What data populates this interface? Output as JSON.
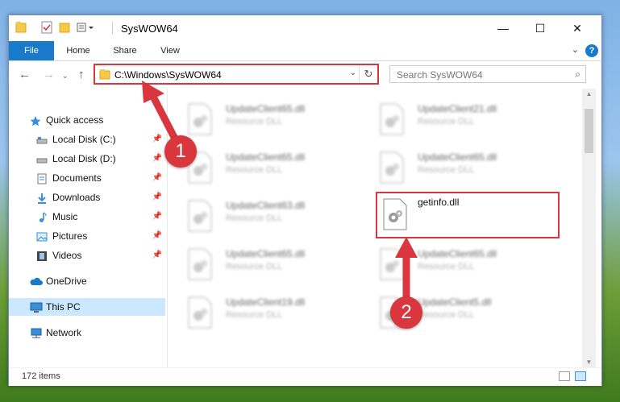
{
  "window": {
    "title": "SysWOW64",
    "controls": {
      "minimize": "—",
      "maximize": "☐",
      "close": "✕"
    }
  },
  "ribbon": {
    "tabs": [
      "File",
      "Home",
      "Share",
      "View"
    ],
    "help": "?"
  },
  "address": {
    "path": "C:\\Windows\\SysWOW64",
    "search_placeholder": "Search SysWOW64"
  },
  "nav_pane": {
    "items": [
      {
        "label": "Quick access",
        "icon": "star-icon",
        "pinned": false
      },
      {
        "label": "Local Disk (C:)",
        "icon": "drive-icon",
        "pinned": true
      },
      {
        "label": "Local Disk (D:)",
        "icon": "drive-icon",
        "pinned": true
      },
      {
        "label": "Documents",
        "icon": "documents-icon",
        "pinned": true
      },
      {
        "label": "Downloads",
        "icon": "download-icon",
        "pinned": true
      },
      {
        "label": "Music",
        "icon": "music-icon",
        "pinned": true
      },
      {
        "label": "Pictures",
        "icon": "pictures-icon",
        "pinned": true
      },
      {
        "label": "Videos",
        "icon": "videos-icon",
        "pinned": true
      },
      {
        "label": "OneDrive",
        "icon": "cloud-icon",
        "pinned": false
      },
      {
        "label": "This PC",
        "icon": "computer-icon",
        "pinned": false,
        "selected": true
      },
      {
        "label": "Network",
        "icon": "network-icon",
        "pinned": false
      }
    ]
  },
  "files": [
    {
      "name": "UpdateClient65.dll",
      "type": "Resource DLL",
      "blurred": true
    },
    {
      "name": "UpdateClient21.dll",
      "type": "Resource DLL",
      "blurred": true
    },
    {
      "name": "UpdateClient65.dll",
      "type": "Resource DLL",
      "blurred": true
    },
    {
      "name": "UpdateClient65.dll",
      "type": "Resource DLL",
      "blurred": true
    },
    {
      "name": "UpdateClient63.dll",
      "type": "Resource DLL",
      "blurred": true
    },
    {
      "name": "getinfo.dll",
      "type": "",
      "blurred": false,
      "highlighted": true
    },
    {
      "name": "UpdateClient65.dll",
      "type": "Resource DLL",
      "blurred": true
    },
    {
      "name": "UpdateClient65.dll",
      "type": "Resource DLL",
      "blurred": true
    },
    {
      "name": "UpdateClient19.dll",
      "type": "Resource DLL",
      "blurred": true
    },
    {
      "name": "UpdateClient5.dll",
      "type": "Resource DLL",
      "blurred": true
    }
  ],
  "status": {
    "item_count": "172 items"
  },
  "annotations": {
    "step1": "1",
    "step2": "2",
    "color": "#d9363e"
  }
}
